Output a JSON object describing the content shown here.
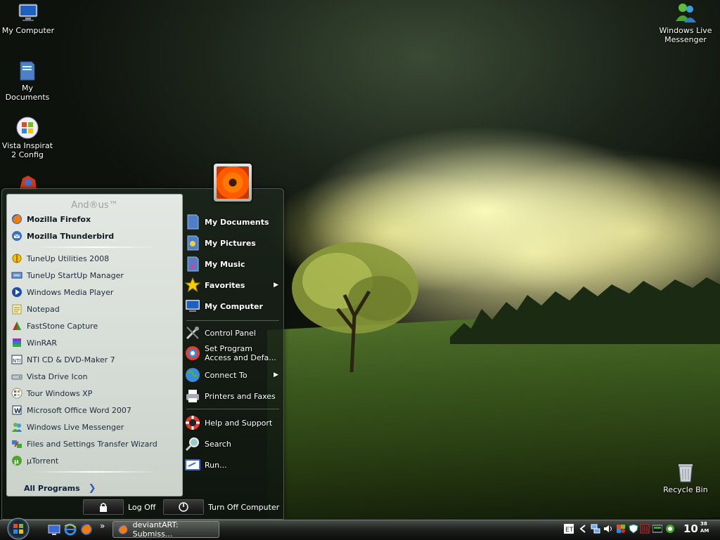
{
  "desktop": {
    "icons": [
      {
        "label": "My Computer",
        "icon": "monitor-icon"
      },
      {
        "label": "My\nDocuments",
        "icon": "folder-documents-icon"
      },
      {
        "label": "Vista Inspirat\n2 Config",
        "icon": "windows-logo-icon"
      },
      {
        "label": "Windows Live\nMessenger",
        "icon": "messenger-buddies-icon"
      },
      {
        "label": "Recycle Bin",
        "icon": "recycle-bin-icon"
      }
    ]
  },
  "start_menu": {
    "user_name": "And®us™",
    "pinned": [
      {
        "label": "Mozilla Firefox",
        "icon": "firefox-icon"
      },
      {
        "label": "Mozilla Thunderbird",
        "icon": "thunderbird-icon"
      }
    ],
    "recent": [
      {
        "label": "TuneUp Utilities 2008",
        "icon": "tuneup-icon"
      },
      {
        "label": "TuneUp StartUp Manager",
        "icon": "startup-manager-icon"
      },
      {
        "label": "Windows Media Player",
        "icon": "media-player-icon"
      },
      {
        "label": "Notepad",
        "icon": "notepad-icon"
      },
      {
        "label": "FastStone Capture",
        "icon": "faststone-icon"
      },
      {
        "label": "WinRAR",
        "icon": "winrar-icon"
      },
      {
        "label": "NTI CD & DVD-Maker 7",
        "icon": "nti-icon"
      },
      {
        "label": "Vista Drive Icon",
        "icon": "drive-icon"
      },
      {
        "label": "Tour Windows XP",
        "icon": "tour-icon"
      },
      {
        "label": "Microsoft Office Word 2007",
        "icon": "word-icon"
      },
      {
        "label": "Windows Live Messenger",
        "icon": "messenger-icon"
      },
      {
        "label": "Files and Settings Transfer Wizard",
        "icon": "transfer-wizard-icon"
      },
      {
        "label": "µTorrent",
        "icon": "utorrent-icon"
      }
    ],
    "all_programs": "All Programs",
    "right": {
      "my_documents": "My Documents",
      "my_pictures": "My Pictures",
      "my_music": "My Music",
      "favorites": "Favorites",
      "my_computer": "My Computer",
      "control_panel": "Control Panel",
      "set_program_1": "Set Program",
      "set_program_2": "Access and Defa...",
      "connect_to": "Connect To",
      "printers": "Printers and Faxes",
      "help": "Help and Support",
      "search": "Search",
      "run": "Run..."
    },
    "log_off": "Log Off",
    "turn_off": "Turn Off Computer"
  },
  "taskbar": {
    "task_label": "deviantART: Submiss...",
    "quicklaunch_more": "»",
    "clock_time": "10",
    "clock_min": "38",
    "clock_ampm": "AM"
  },
  "colors": {
    "start_left_bg": "#e8ece8",
    "accent_text": "#102040",
    "taskbar": "#1f221f"
  }
}
